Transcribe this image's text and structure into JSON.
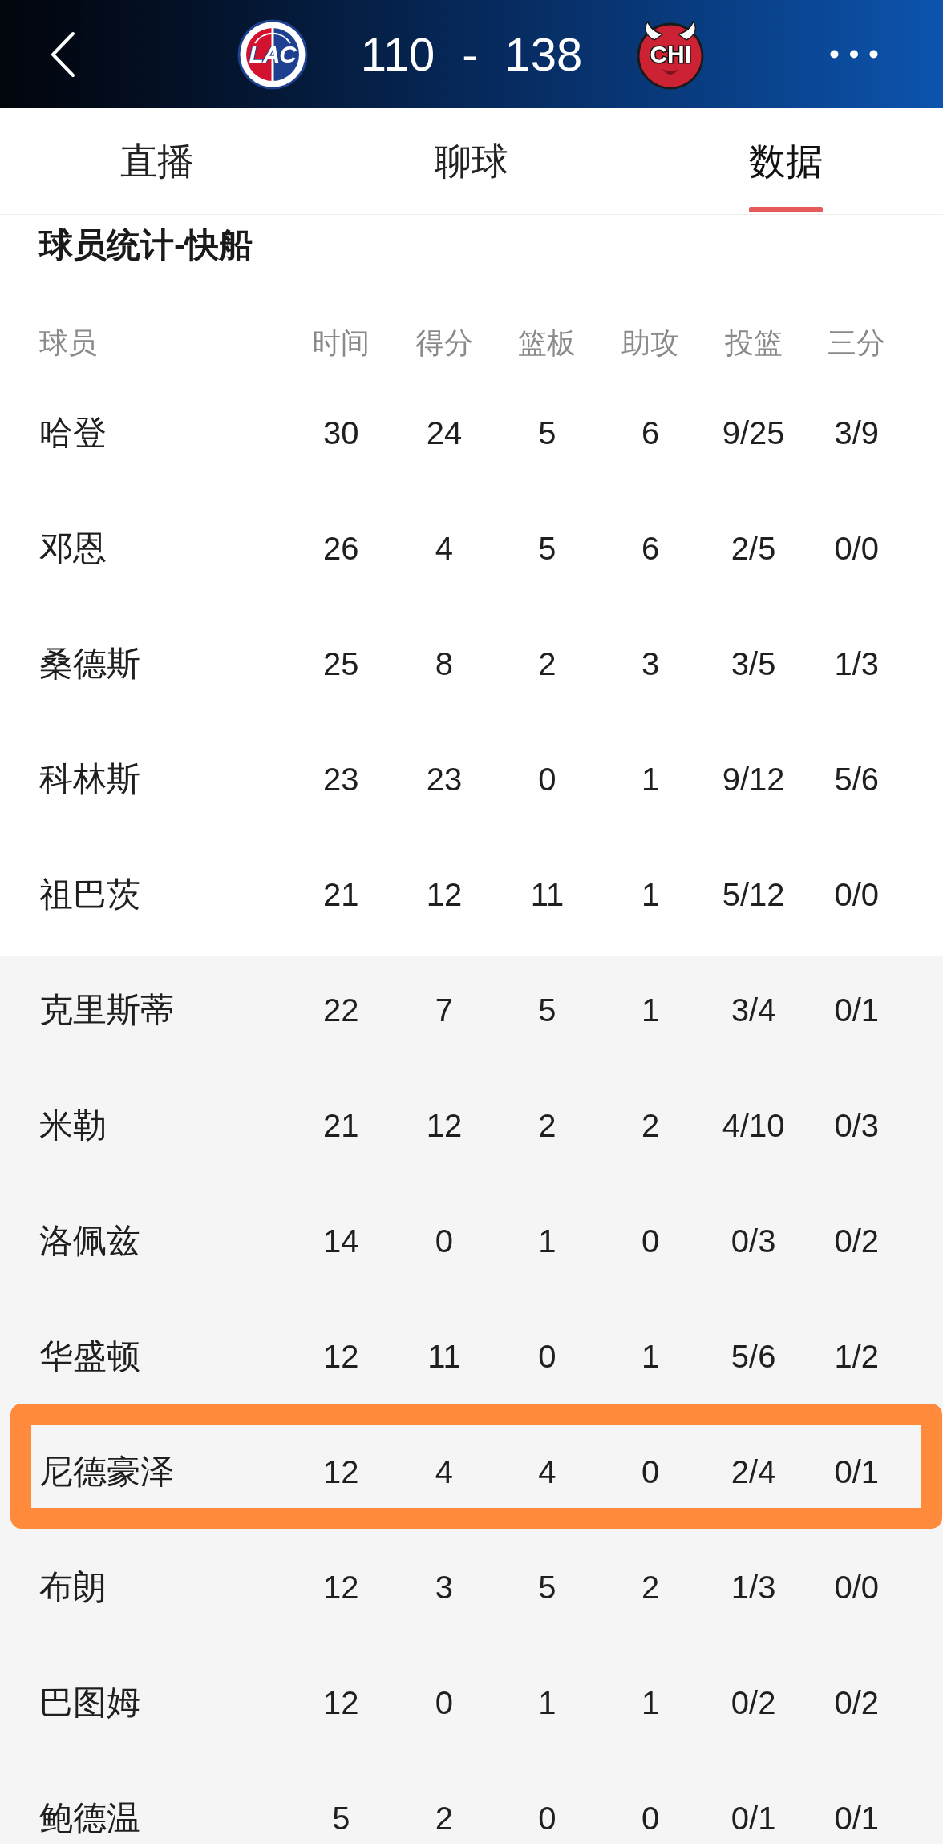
{
  "header": {
    "home_team": {
      "kind": "split",
      "logo_text": "LAC"
    },
    "score": {
      "home": "110",
      "separator": "-",
      "away": "138"
    },
    "away_team": {
      "kind": "horned",
      "logo_text": "CHI"
    }
  },
  "tabs": [
    {
      "label": "直播",
      "selected": false
    },
    {
      "label": "聊球",
      "selected": false
    },
    {
      "label": "数据",
      "selected": true
    }
  ],
  "section_title": "球员统计-快船",
  "table": {
    "columns": [
      "球员",
      "时间",
      "得分",
      "篮板",
      "助攻",
      "投篮",
      "三分"
    ],
    "rows": [
      {
        "kind": "starter",
        "highlighted": false,
        "cells": [
          "哈登",
          "30",
          "24",
          "5",
          "6",
          "9/25",
          "3/9"
        ]
      },
      {
        "kind": "starter",
        "highlighted": false,
        "cells": [
          "邓恩",
          "26",
          "4",
          "5",
          "6",
          "2/5",
          "0/0"
        ]
      },
      {
        "kind": "starter",
        "highlighted": false,
        "cells": [
          "桑德斯",
          "25",
          "8",
          "2",
          "3",
          "3/5",
          "1/3"
        ]
      },
      {
        "kind": "starter",
        "highlighted": false,
        "cells": [
          "科林斯",
          "23",
          "23",
          "0",
          "1",
          "9/12",
          "5/6"
        ]
      },
      {
        "kind": "starter",
        "highlighted": false,
        "cells": [
          "祖巴茨",
          "21",
          "12",
          "11",
          "1",
          "5/12",
          "0/0"
        ]
      },
      {
        "kind": "bench",
        "highlighted": false,
        "cells": [
          "克里斯蒂",
          "22",
          "7",
          "5",
          "1",
          "3/4",
          "0/1"
        ]
      },
      {
        "kind": "bench",
        "highlighted": false,
        "cells": [
          "米勒",
          "21",
          "12",
          "2",
          "2",
          "4/10",
          "0/3"
        ]
      },
      {
        "kind": "bench",
        "highlighted": false,
        "cells": [
          "洛佩兹",
          "14",
          "0",
          "1",
          "0",
          "0/3",
          "0/2"
        ]
      },
      {
        "kind": "bench",
        "highlighted": false,
        "cells": [
          "华盛顿",
          "12",
          "11",
          "0",
          "1",
          "5/6",
          "1/2"
        ]
      },
      {
        "kind": "bench",
        "highlighted": true,
        "cells": [
          "尼德豪泽",
          "12",
          "4",
          "4",
          "0",
          "2/4",
          "0/1"
        ]
      },
      {
        "kind": "bench",
        "highlighted": false,
        "cells": [
          "布朗",
          "12",
          "3",
          "5",
          "2",
          "1/3",
          "0/0"
        ]
      },
      {
        "kind": "bench",
        "highlighted": false,
        "cells": [
          "巴图姆",
          "12",
          "0",
          "1",
          "1",
          "0/2",
          "0/2"
        ]
      },
      {
        "kind": "bench",
        "highlighted": false,
        "cells": [
          "鲍德温",
          "5",
          "2",
          "0",
          "0",
          "0/1",
          "0/1"
        ]
      }
    ]
  }
}
